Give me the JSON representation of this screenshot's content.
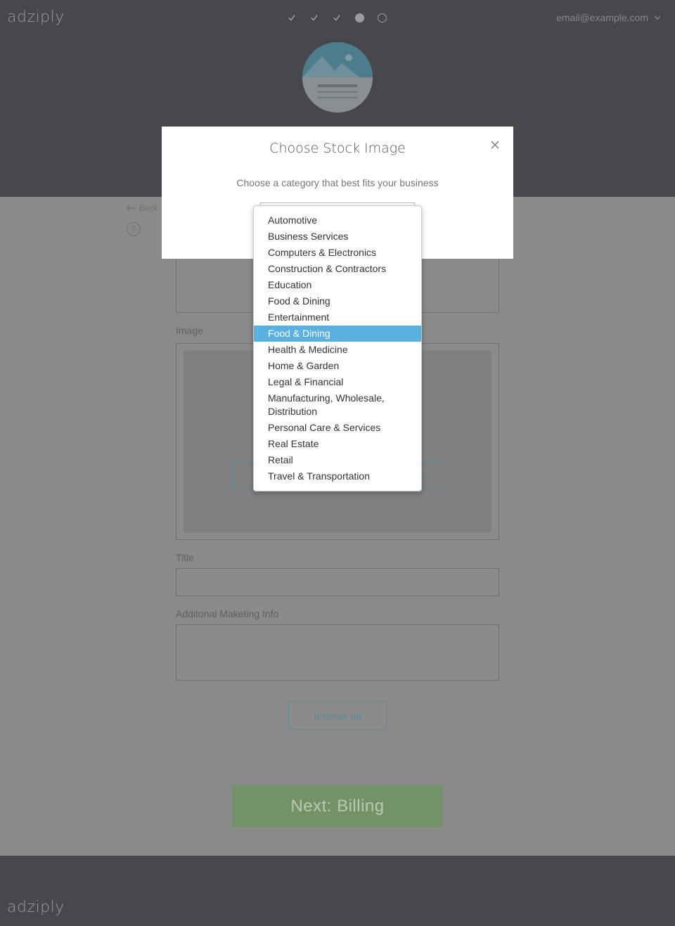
{
  "app": {
    "logo": "adziply"
  },
  "header": {
    "user_email": "email@example.com",
    "steps": [
      "done",
      "done",
      "done",
      "current",
      "upcoming"
    ]
  },
  "page": {
    "back_label": "Back",
    "help_label": "?",
    "image_label": "Image",
    "stock_button_text": "ge",
    "title_label": "Title",
    "marketing_label": "Additonal Maketing Info",
    "preview_label": "preview ad",
    "next_label": "Next: Billing"
  },
  "modal": {
    "title": "Choose Stock Image",
    "subtitle": "Choose a category that best fits your business"
  },
  "dropdown": {
    "options": [
      "Automotive",
      "Business Services",
      "Computers & Electronics",
      "Construction & Contractors",
      "Education",
      "Food & Dining",
      "Entertainment",
      "Food & Dining",
      "Health & Medicine",
      "Home & Garden",
      "Legal & Financial",
      "Manufacturing, Wholesale, Distribution",
      "Personal Care & Services",
      "Real Estate",
      "Retail",
      "Travel & Transportation"
    ],
    "highlighted_index": 7
  },
  "colors": {
    "header_bg": "#46484b",
    "overlay_bg": "#8a8a8a",
    "highlight": "#5ab0e0",
    "next_button": "#749269"
  }
}
